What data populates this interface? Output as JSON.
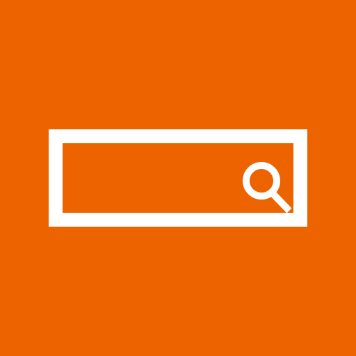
{
  "colors": {
    "background": "#EC6300",
    "foreground": "#FFFFFF"
  },
  "search": {
    "value": "",
    "placeholder": "",
    "icon": "search-icon"
  }
}
